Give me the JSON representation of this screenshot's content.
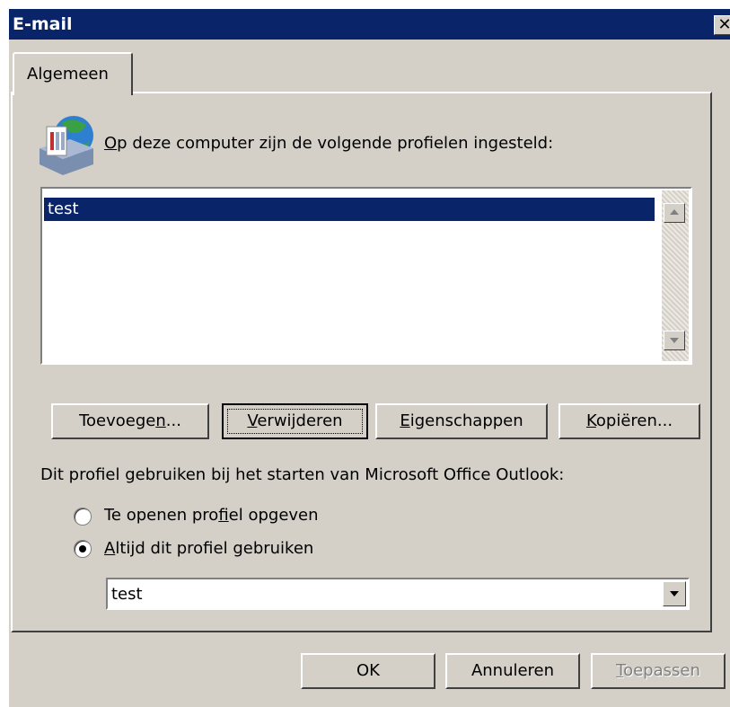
{
  "window": {
    "title": "E-mail",
    "close_glyph": "✕"
  },
  "tabs": [
    {
      "label": "Algemeen"
    }
  ],
  "profiles": {
    "prompt_label": "Op deze computer zijn de volgende profielen ingesteld:",
    "prompt_mnemonic": "O",
    "prompt_rest": "p deze computer zijn de volgende profielen ingesteld:",
    "items": [
      "test"
    ],
    "selected": "test",
    "icon": "mail-profile-icon"
  },
  "buttons": {
    "add": {
      "label": "Toevoegen...",
      "pre": "Toevoege",
      "mn": "n",
      "post": "..."
    },
    "remove": {
      "label": "Verwijderen",
      "pre": "",
      "mn": "V",
      "post": "erwijderen"
    },
    "properties": {
      "label": "Eigenschappen",
      "pre": "",
      "mn": "E",
      "post": "igenschappen"
    },
    "copy": {
      "label": "Kopiëren...",
      "pre": "",
      "mn": "K",
      "post": "opiëren..."
    }
  },
  "startup": {
    "label": "Dit profiel gebruiken bij het starten van Microsoft Office Outlook:",
    "option_prompt": {
      "label": "Te openen profiel opgeven",
      "pre": "Te openen pro",
      "mn": "f",
      "post": "iel opgeven",
      "selected": false
    },
    "option_always": {
      "label": "Altijd dit profiel gebruiken",
      "pre": "",
      "mn": "A",
      "post": "ltijd dit profiel gebruiken",
      "selected": true
    },
    "combo_value": "test"
  },
  "footer": {
    "ok": "OK",
    "cancel": "Annuleren",
    "apply": {
      "label": "Toepassen",
      "mn": "T",
      "post": "oepassen",
      "disabled": true
    }
  },
  "colors": {
    "titlebar": "#0a246a",
    "selection": "#0a246a",
    "face": "#d4d0c8"
  }
}
